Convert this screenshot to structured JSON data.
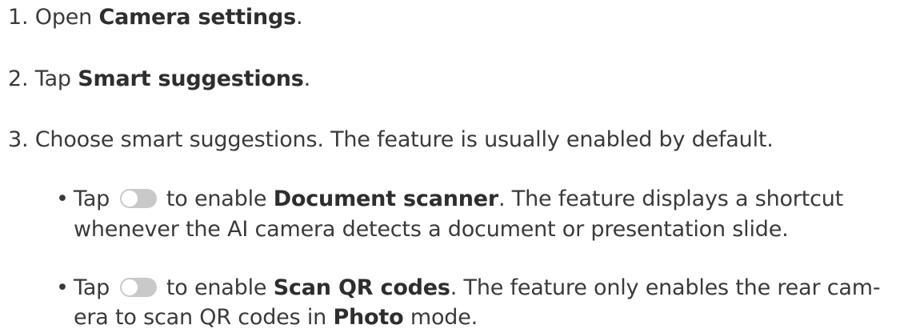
{
  "steps": [
    {
      "num": "1.",
      "pre": "Open ",
      "bold": "Camera settings",
      "post": "."
    },
    {
      "num": "2.",
      "pre": "Tap ",
      "bold": "Smart suggestions",
      "post": "."
    },
    {
      "num": "3.",
      "text": "Choose smart suggestions. The feature is usually enabled by default."
    }
  ],
  "bullets": [
    {
      "dot": "•",
      "tap": "Tap",
      "mid": " to enable ",
      "bold": "Document scanner",
      "rest": ". The feature displays a shortcut",
      "line2": "whenever the AI camera detects a document or presentation slide."
    },
    {
      "dot": "•",
      "tap": "Tap",
      "mid": " to enable ",
      "bold": "Scan QR codes",
      "rest": ". The feature only enables the rear cam-",
      "line2_pre": "era to scan QR codes in ",
      "line2_bold": "Photo",
      "line2_post": " mode."
    }
  ],
  "toggle_icon": "toggle-off-icon"
}
